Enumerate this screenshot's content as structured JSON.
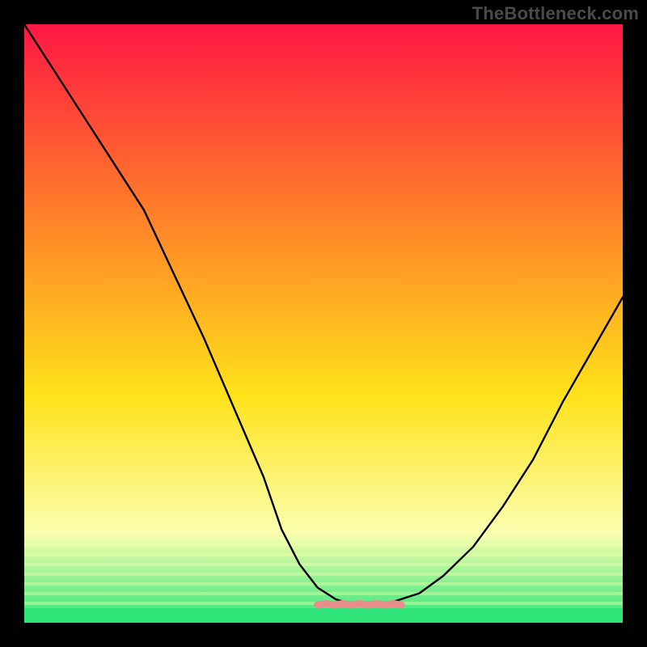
{
  "watermark": {
    "text": "TheBottleneck.com"
  },
  "colors": {
    "top": "#ff1744",
    "mid_upper": "#ff7a2a",
    "mid": "#ffe21a",
    "lowlight": "#fbffb0",
    "base": "#2fe57a",
    "curve": "#000000",
    "highlight_pink": "#e88d8b"
  },
  "chart_data": {
    "type": "line",
    "title": "",
    "xlabel": "",
    "ylabel": "",
    "xlim": [
      0,
      1
    ],
    "ylim": [
      0,
      1
    ],
    "x": [
      0.0,
      0.05,
      0.1,
      0.15,
      0.2,
      0.25,
      0.3,
      0.35,
      0.4,
      0.43,
      0.46,
      0.49,
      0.52,
      0.55,
      0.58,
      0.6,
      0.63,
      0.66,
      0.7,
      0.75,
      0.8,
      0.85,
      0.9,
      0.95,
      1.0
    ],
    "series": [
      {
        "name": "bottleneck-curve",
        "values": [
          1.0,
          0.92,
          0.84,
          0.76,
          0.68,
          0.57,
          0.46,
          0.34,
          0.22,
          0.13,
          0.07,
          0.03,
          0.01,
          0.0,
          0.0,
          0.0,
          0.01,
          0.02,
          0.05,
          0.1,
          0.17,
          0.25,
          0.35,
          0.44,
          0.53
        ]
      }
    ],
    "highlight_floor": {
      "x_range": [
        0.49,
        0.63
      ],
      "y": 0.0
    }
  }
}
